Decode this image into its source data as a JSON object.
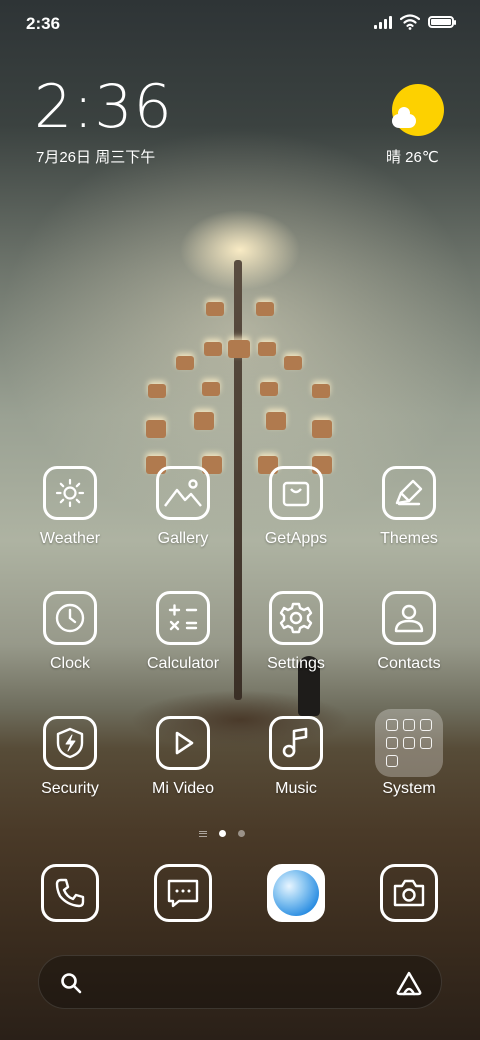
{
  "status_bar": {
    "time": "2:36"
  },
  "clock_widget": {
    "time": "2:36",
    "date": "7月26日 周三下午"
  },
  "weather_widget": {
    "text": "晴 26℃"
  },
  "apps": [
    {
      "label": "Weather",
      "icon": "sun-icon"
    },
    {
      "label": "Gallery",
      "icon": "image-icon"
    },
    {
      "label": "GetApps",
      "icon": "shopping-bag-icon"
    },
    {
      "label": "Themes",
      "icon": "brush-icon"
    },
    {
      "label": "Clock",
      "icon": "clock-icon"
    },
    {
      "label": "Calculator",
      "icon": "calculator-icon"
    },
    {
      "label": "Settings",
      "icon": "gear-icon"
    },
    {
      "label": "Contacts",
      "icon": "person-icon"
    },
    {
      "label": "Security",
      "icon": "shield-icon"
    },
    {
      "label": "Mi Video",
      "icon": "play-icon"
    },
    {
      "label": "Music",
      "icon": "music-note-icon"
    },
    {
      "label": "System",
      "icon": "folder-icon"
    }
  ],
  "dock": [
    {
      "name": "Phone",
      "icon": "phone-icon"
    },
    {
      "name": "Messages",
      "icon": "message-icon"
    },
    {
      "name": "Browser",
      "icon": "browser-icon"
    },
    {
      "name": "Camera",
      "icon": "camera-icon"
    }
  ],
  "page_indicator": {
    "pages": 2,
    "current": 1
  },
  "search_bar": {
    "left_icon": "search-icon",
    "right_icon": "assistant-icon"
  },
  "colors": {
    "sun": "#fdd100",
    "icon_stroke": "#ffffff",
    "browser_blue": "#2c8ee2"
  }
}
